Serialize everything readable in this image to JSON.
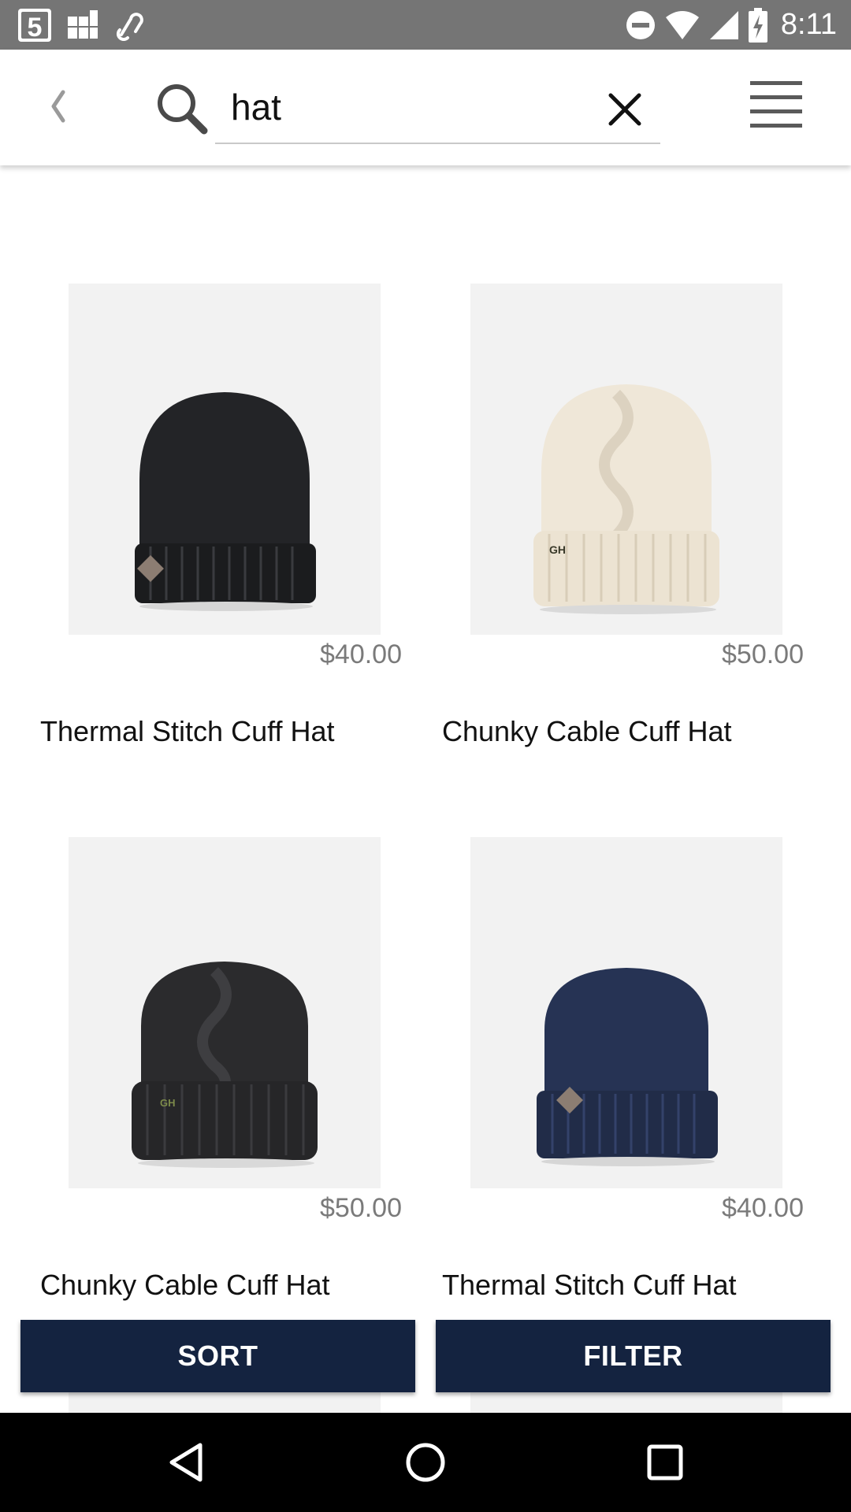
{
  "status_bar": {
    "time": "8:11",
    "left_icons": [
      "channel-5-icon",
      "grid-app-icon",
      "link-app-icon"
    ],
    "right_icons": [
      "do-not-disturb-icon",
      "wifi-icon",
      "signal-icon",
      "battery-charging-icon"
    ]
  },
  "toolbar": {
    "back_icon": "chevron-left-icon",
    "search_icon": "search-icon",
    "search_value": "hat",
    "clear_icon": "close-icon",
    "menu_icon": "hamburger-menu-icon"
  },
  "products": [
    {
      "name": "Thermal Stitch Cuff Hat",
      "price": "$40.00",
      "color": "#232427"
    },
    {
      "name": "Chunky Cable Cuff Hat",
      "price": "$50.00",
      "color": "#efe7d8"
    },
    {
      "name": "Chunky Cable Cuff Hat",
      "price": "$50.00",
      "color": "#2b2b2d"
    },
    {
      "name": "Thermal Stitch Cuff Hat",
      "price": "$40.00",
      "color": "#263354"
    }
  ],
  "actions": {
    "sort_label": "SORT",
    "filter_label": "FILTER",
    "accent": "#142340"
  },
  "nav": {
    "back_icon": "nav-back-triangle-icon",
    "home_icon": "nav-home-circle-icon",
    "recents_icon": "nav-recents-square-icon"
  }
}
